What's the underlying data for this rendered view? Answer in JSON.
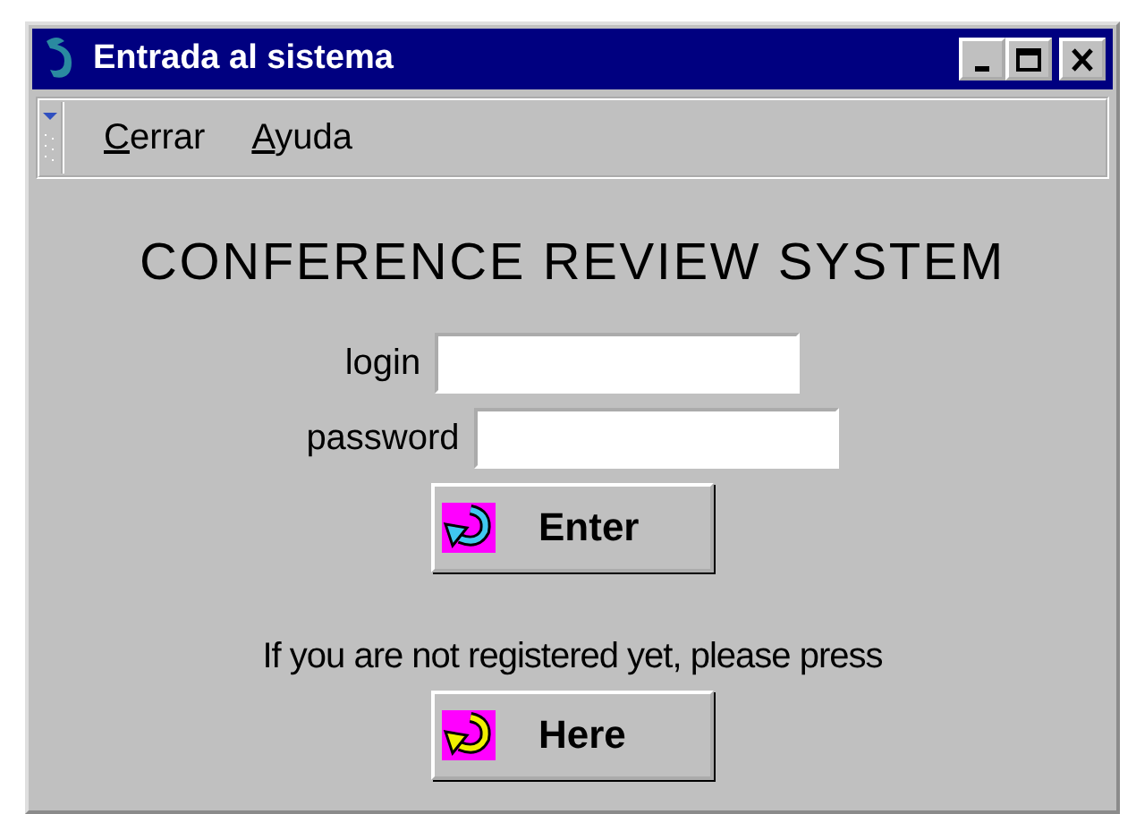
{
  "window": {
    "title": "Entrada al sistema"
  },
  "menu": [
    {
      "label": "Cerrar"
    },
    {
      "label": "Ayuda"
    }
  ],
  "heading": "CONFERENCE REVIEW SYSTEM",
  "fields": [
    {
      "label": "login"
    },
    {
      "label": "password"
    }
  ],
  "enter_button": {
    "label": "Enter",
    "kind": "enter"
  },
  "register_prompt": "If you are not registered yet, please press",
  "here_button": {
    "label": "Here",
    "kind": "here"
  }
}
